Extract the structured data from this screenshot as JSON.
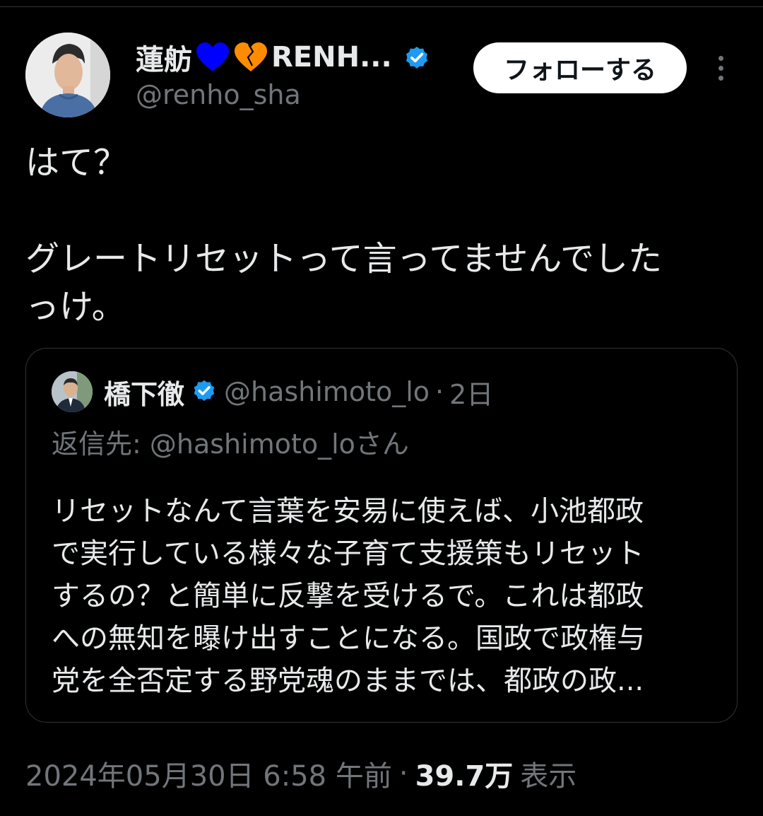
{
  "header": {
    "display_name": "蓮舫",
    "display_name_suffix": "RENH...",
    "handle": "@renho_sha",
    "follow_label": "フォローする",
    "verified": true
  },
  "tweet": {
    "text": "はて？\n\nグレートリセットって言ってませんでした\nっけ。"
  },
  "quoted_tweet": {
    "name": "橋下徹",
    "verified": true,
    "handle": "@hashimoto_lo",
    "separator": "·",
    "time": "2日",
    "reply_to": "返信先: @hashimoto_loさん",
    "text": "リセットなんて言葉を安易に使えば、小池都政\nで実行している様々な子育て支援策もリセット\nするの？と簡単に反撃を受けるで。これは都政\nへの無知を曝け出すことになる。国政で政権与\n党を全否定する野党魂のままでは、都政の政..."
  },
  "meta": {
    "timestamp": "2024年05月30日 6:58 午前",
    "separator": "·",
    "views_count": "39.7万",
    "views_label": "表示"
  },
  "colors": {
    "background": "#000000",
    "text_primary": "#e7e9ea",
    "text_secondary": "#71767b",
    "verified_badge": "#1d9bf0",
    "blue_heart": "#0000ff",
    "orange_heart": "#ff8c00",
    "border": "#2f3336"
  },
  "icons": [
    "blue-heart-icon",
    "orange-heart-icon",
    "verified-badge-icon",
    "more-options-icon"
  ]
}
